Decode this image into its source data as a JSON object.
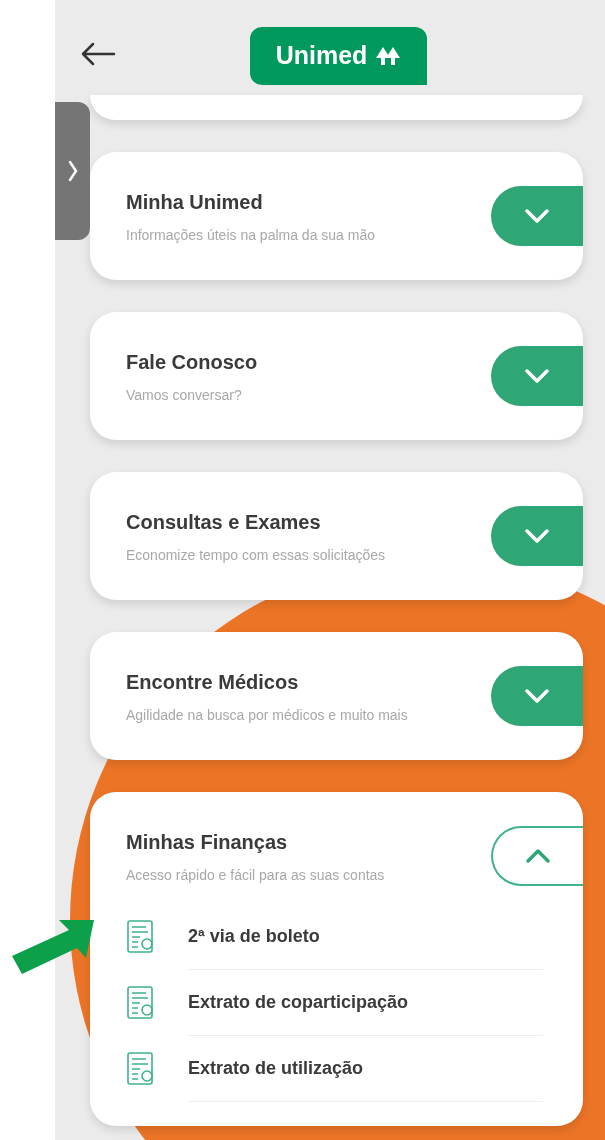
{
  "header": {
    "logo": "Unimed"
  },
  "sections": [
    {
      "title": "Minha Unimed",
      "subtitle": "Informações úteis na palma da sua mão",
      "expanded": false
    },
    {
      "title": "Fale Conosco",
      "subtitle": "Vamos conversar?",
      "expanded": false
    },
    {
      "title": "Consultas e Exames",
      "subtitle": "Economize tempo com essas solicitações",
      "expanded": false
    },
    {
      "title": "Encontre Médicos",
      "subtitle": "Agilidade na busca por médicos e muito mais",
      "expanded": false
    },
    {
      "title": "Minhas Finanças",
      "subtitle": "Acesso rápido e fácil para as suas contas",
      "expanded": true,
      "items": [
        {
          "label": "2ª via de boleto",
          "highlighted": true
        },
        {
          "label": "Extrato de coparticipação",
          "highlighted": false
        },
        {
          "label": "Extrato de utilização",
          "highlighted": false
        }
      ]
    }
  ]
}
